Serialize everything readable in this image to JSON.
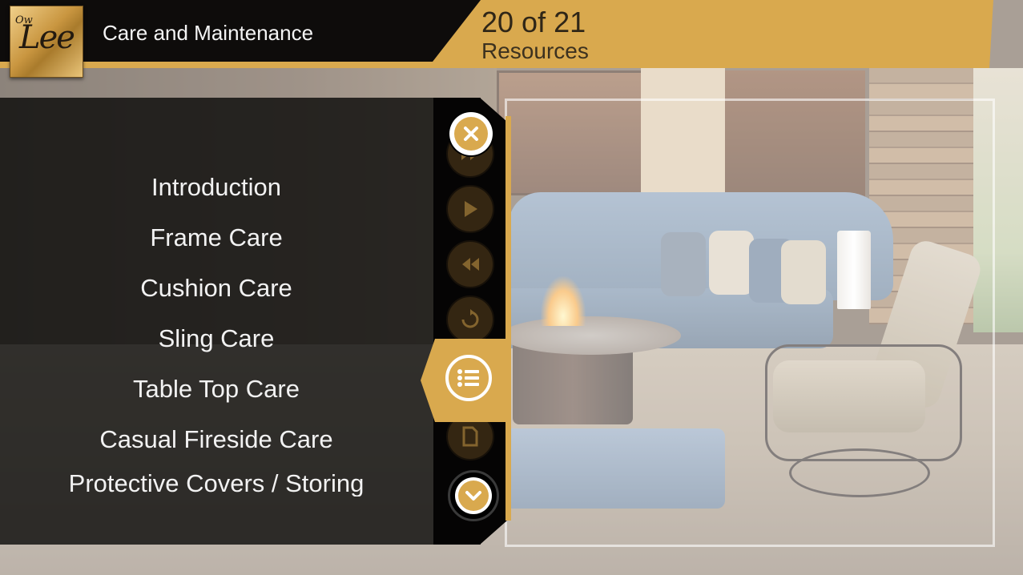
{
  "header": {
    "logo_text": "OW Lee",
    "title": "Care and Maintenance",
    "resource_count": "20 of 21",
    "resource_label": "Resources"
  },
  "menu": {
    "items": [
      {
        "label": "Introduction"
      },
      {
        "label": "Frame Care"
      },
      {
        "label": "Cushion Care"
      },
      {
        "label": "Sling Care"
      },
      {
        "label": "Table Top Care"
      },
      {
        "label": "Casual Fireside Care"
      },
      {
        "label": "Protective Covers / Storing"
      }
    ]
  },
  "rail": {
    "buttons": [
      {
        "icon": "close-icon"
      },
      {
        "icon": "fast-forward-icon"
      },
      {
        "icon": "play-icon"
      },
      {
        "icon": "rewind-icon"
      },
      {
        "icon": "replay-icon"
      },
      {
        "icon": "list-icon"
      },
      {
        "icon": "document-icon"
      },
      {
        "icon": "chevron-down-icon"
      }
    ]
  },
  "colors": {
    "accent_gold": "#d9a94e",
    "panel_dark": "#0e0c0b",
    "text_light": "#f2f2f2"
  }
}
